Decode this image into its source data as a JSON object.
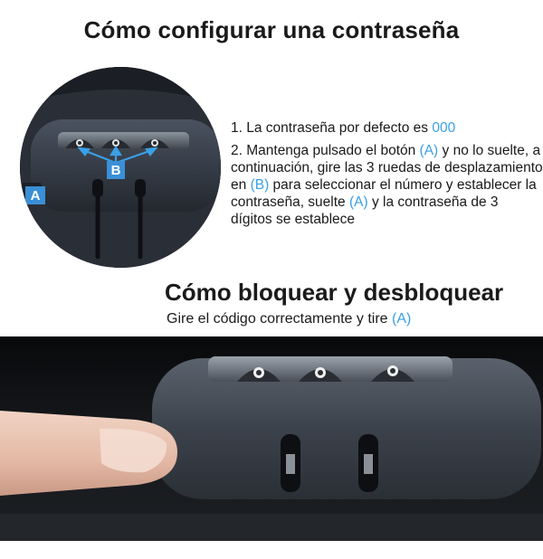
{
  "header": {
    "title": "Cómo configurar una contraseña"
  },
  "setup": {
    "callout_a": "A",
    "callout_b": "B",
    "step1_text": "1. La contraseña por defecto es ",
    "step1_code": "000",
    "step2_part1": "2. Mantenga pulsado el botón ",
    "step2_ref_a1": "(A)",
    "step2_part2": " y no lo suelte, a continuación, gire las 3 ruedas de desplazamiento en ",
    "step2_ref_b": "(B)",
    "step2_part3": " para seleccionar el número y establecer la contraseña, suelte ",
    "step2_ref_a2": "(A)",
    "step2_part4": " y la contraseña de 3 dígitos se establece"
  },
  "lock_section": {
    "title": "Cómo bloquear y desbloquear",
    "instruction_text": "Gire el código correctamente y tire ",
    "instruction_ref": "(A)"
  },
  "colors": {
    "accent": "#3aa0e6",
    "text": "#1a1a1a",
    "callout_box": "#3a8fd6"
  }
}
